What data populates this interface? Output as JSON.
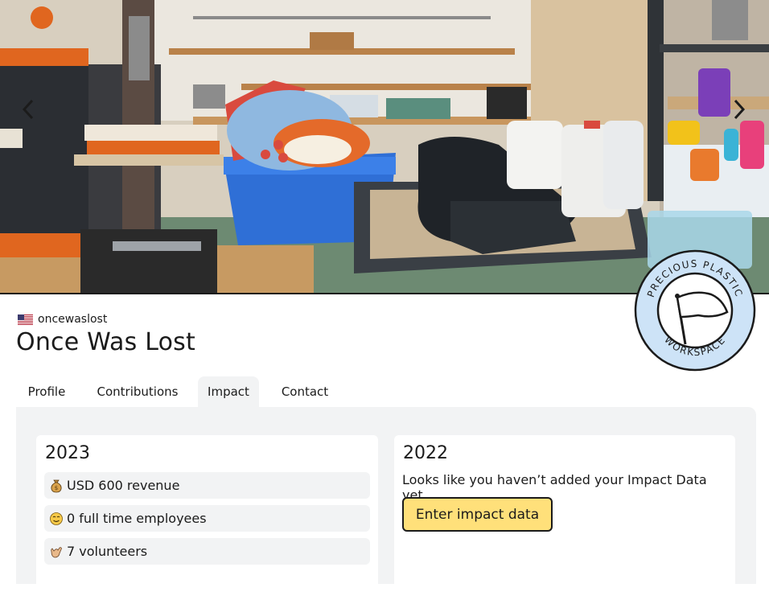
{
  "workspace": {
    "username": "oncewaslost",
    "name": "Once Was Lost",
    "badge_text_top": "PRECIOUS PLASTIC",
    "badge_text_bottom": "WORKSPACE"
  },
  "tabs": [
    {
      "label": "Profile",
      "active": false
    },
    {
      "label": "Contributions",
      "active": false
    },
    {
      "label": "Impact",
      "active": true
    },
    {
      "label": "Contact",
      "active": false
    }
  ],
  "impact": {
    "year_2023": {
      "title": "2023",
      "stats": [
        {
          "icon": "money-bag-icon",
          "text": "USD 600 revenue"
        },
        {
          "icon": "smiley-icon",
          "text": "0 full time employees"
        },
        {
          "icon": "shaka-hand-icon",
          "text": "7 volunteers"
        }
      ]
    },
    "year_2022": {
      "title": "2022",
      "message": "Looks like you haven’t added your Impact Data yet.",
      "button_label": "Enter impact data"
    }
  },
  "colors": {
    "accent_button": "#ffe07a",
    "panel_bg": "#f2f3f4",
    "badge_fill": "#cde3f7"
  }
}
